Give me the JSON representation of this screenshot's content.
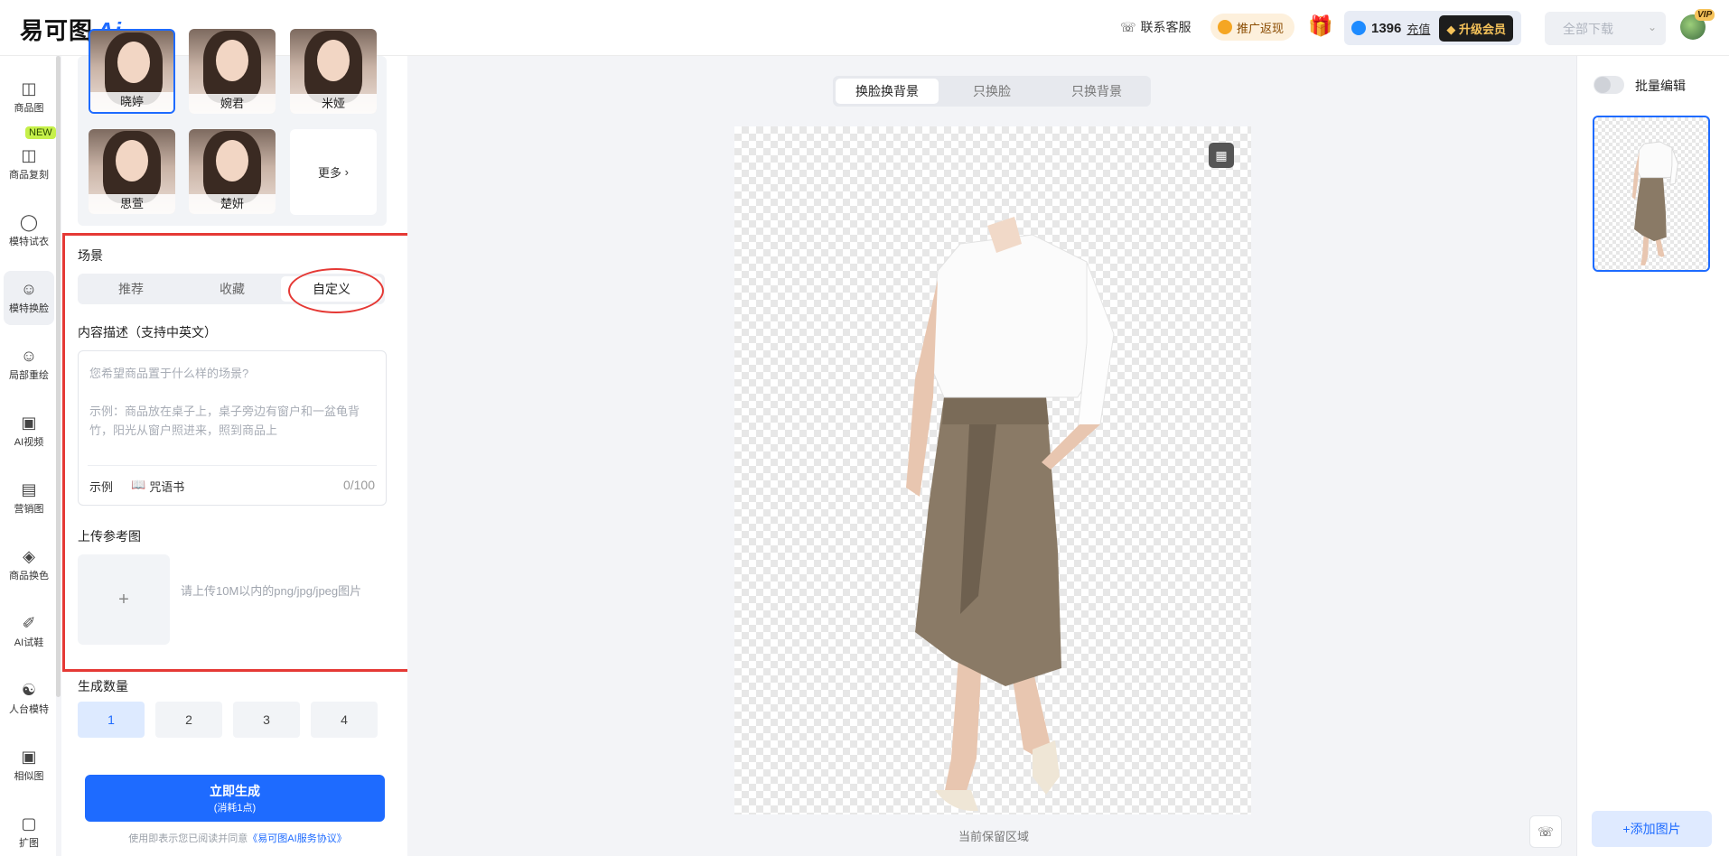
{
  "header": {
    "logo_text": "易可图",
    "logo_ai": "Ai",
    "service_label": "联系客服",
    "promo_label": "推广返现",
    "balance": "1396",
    "recharge_label": "充值",
    "upgrade_label": "升级会员",
    "download_label": "全部下载",
    "vip_badge": "VIP"
  },
  "rail": {
    "new_badge": "NEW",
    "items": [
      {
        "label": "商品图",
        "icon": "bag-icon"
      },
      {
        "label": "商品复刻",
        "icon": "copy-bag-icon"
      },
      {
        "label": "模特试衣",
        "icon": "shirt-icon"
      },
      {
        "label": "模特换脸",
        "icon": "face-icon"
      },
      {
        "label": "局部重绘",
        "icon": "repaint-icon"
      },
      {
        "label": "AI视频",
        "icon": "video-icon"
      },
      {
        "label": "营销图",
        "icon": "poster-icon"
      },
      {
        "label": "商品换色",
        "icon": "drop-icon"
      },
      {
        "label": "AI试鞋",
        "icon": "shoe-icon"
      },
      {
        "label": "人台模特",
        "icon": "mannequin-icon"
      },
      {
        "label": "相似图",
        "icon": "similar-icon"
      },
      {
        "label": "扩图",
        "icon": "expand-icon"
      }
    ]
  },
  "models": {
    "items": [
      {
        "name": "晓婷"
      },
      {
        "name": "婉君"
      },
      {
        "name": "米娅"
      },
      {
        "name": "思萱"
      },
      {
        "name": "楚妍"
      }
    ],
    "more_label": "更多"
  },
  "scene": {
    "title": "场景",
    "tabs": [
      "推荐",
      "收藏",
      "自定义"
    ],
    "desc_title": "内容描述（支持中英文）",
    "placeholder": "您希望商品置于什么样的场景?",
    "example_text": "示例：商品放在桌子上，桌子旁边有窗户和一盆龟背竹，阳光从窗户照进来，照到商品上",
    "example_label": "示例",
    "spellbook_label": "咒语书",
    "counter": "0/100",
    "upload_title": "上传参考图",
    "upload_hint": "请上传10M以内的png/jpg/jpeg图片"
  },
  "generate": {
    "count_title": "生成数量",
    "counts": [
      "1",
      "2",
      "3",
      "4"
    ],
    "button_label": "立即生成",
    "button_cost": "(消耗1点)",
    "agree_text": "使用即表示您已阅读并同意",
    "agree_link": "《易可图AI服务协议》"
  },
  "canvas": {
    "modes": [
      "换脸换背景",
      "只换脸",
      "只换背景"
    ],
    "caption": "当前保留区域"
  },
  "right": {
    "batch_label": "批量编辑",
    "add_label": "+添加图片"
  },
  "colors": {
    "accent": "#1e6bff",
    "annotation_red": "#e53935",
    "skirt": "#8a7a66"
  }
}
